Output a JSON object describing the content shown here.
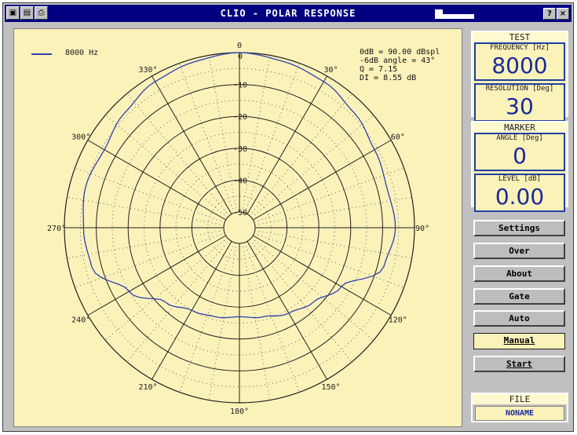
{
  "window": {
    "title": "CLIO - POLAR RESPONSE",
    "controls": {
      "help": "?",
      "close": "×"
    }
  },
  "legend": {
    "label": "8000 Hz",
    "color": "#2f3fb0"
  },
  "info": {
    "line1": "0dB = 90.00 dBspl",
    "line2": "-6dB angle = 43°",
    "line3": "Q = 7.15",
    "line4": "DI = 8.55 dB"
  },
  "test_panel": {
    "title": "TEST",
    "frequency_label": "FREQUENCY [Hz]",
    "frequency_value": "8000",
    "resolution_label": "RESOLUTION [Deg]",
    "resolution_value": "30"
  },
  "marker_panel": {
    "title": "MARKER",
    "angle_label": "ANGLE [Deg]",
    "angle_value": "0",
    "level_label": "LEVEL [dB]",
    "level_value": "0.00"
  },
  "buttons": {
    "settings": "Settings",
    "over": "Over",
    "about": "About",
    "gate": "Gate",
    "auto": "Auto",
    "manual": "Manual",
    "start": "Start"
  },
  "file_panel": {
    "title": "FILE",
    "value": "NONAME"
  },
  "chart_data": {
    "type": "polar",
    "angle_labels": [
      "0",
      "30°",
      "60°",
      "90°",
      "120°",
      "150°",
      "180°",
      "210°",
      "240°",
      "270°",
      "300°",
      "330°"
    ],
    "radial_labels": [
      "0",
      "-10",
      "-20",
      "-30",
      "-40",
      "-50"
    ],
    "rlim": [
      -50,
      0
    ],
    "grid": true,
    "legend_position": "top-left",
    "series": [
      {
        "name": "8000 Hz",
        "angles_deg": [
          0,
          15,
          30,
          45,
          60,
          75,
          90,
          105,
          120,
          135,
          150,
          165,
          180,
          195,
          210,
          225,
          240,
          255,
          270,
          285,
          300,
          315,
          330,
          345
        ],
        "levels_db": [
          0,
          -1,
          -2,
          -4,
          -6,
          -7,
          -6,
          -8,
          -18,
          -22,
          -24,
          -26,
          -27,
          -26,
          -25,
          -22,
          -15,
          -7,
          -6,
          -5,
          -6,
          -4,
          -2,
          -1
        ]
      }
    ]
  }
}
